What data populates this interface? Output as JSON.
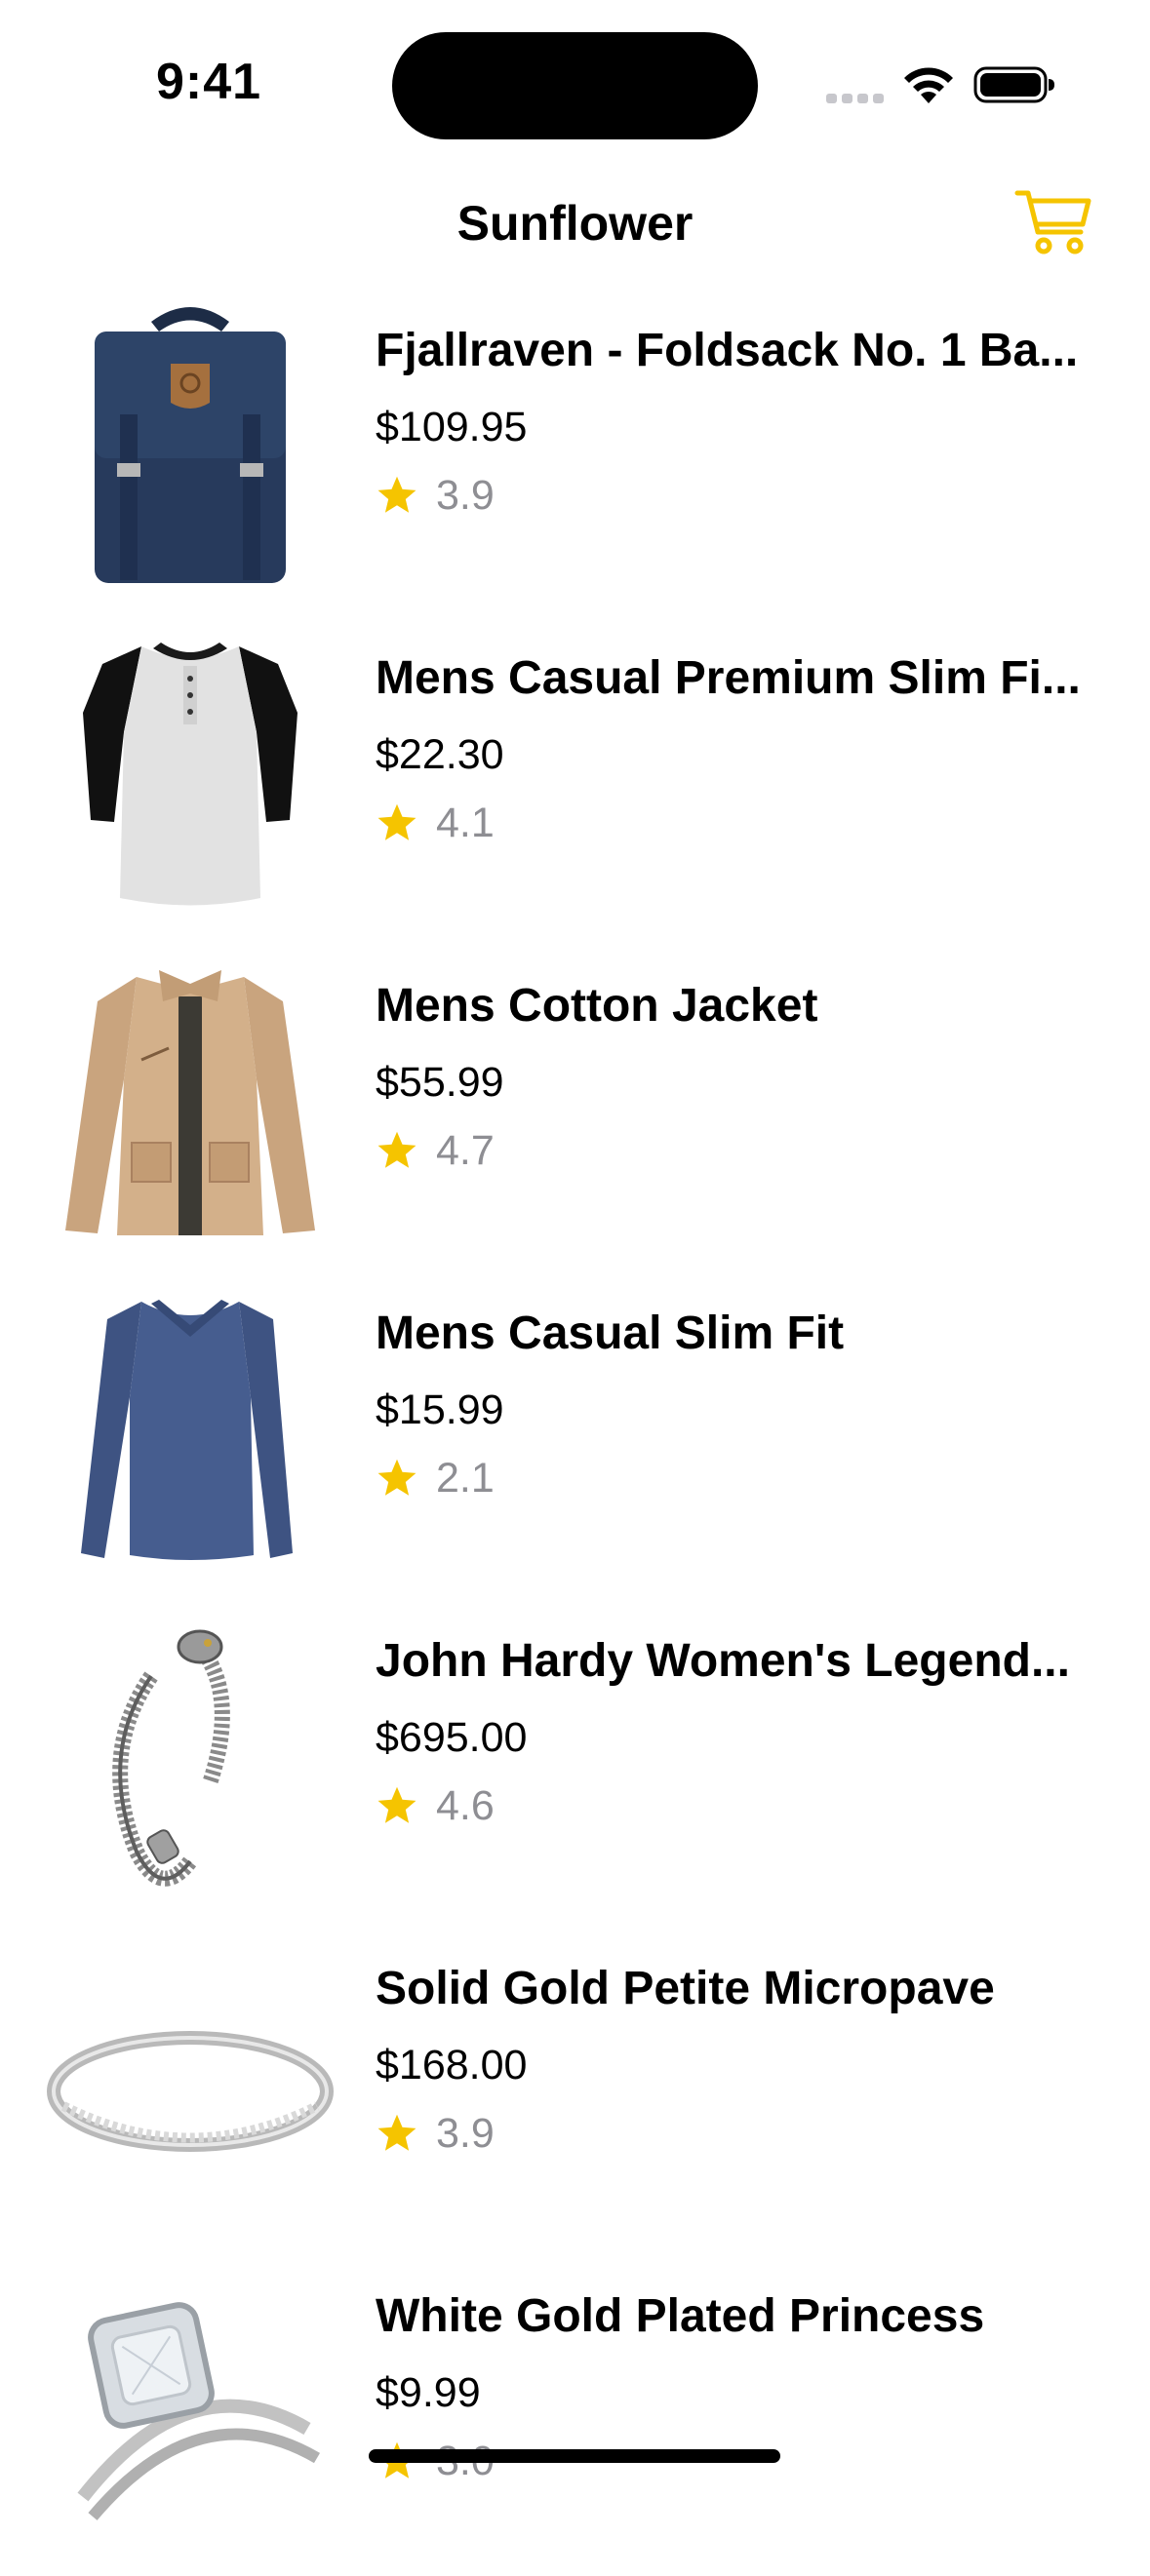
{
  "status_bar": {
    "time": "9:41"
  },
  "nav": {
    "title": "Sunflower",
    "cart_icon": "cart-icon"
  },
  "colors": {
    "accent": "#F5C400",
    "secondary_text": "#8E8E93"
  },
  "products": [
    {
      "title": "Fjallraven - Foldsack No. 1 Ba...",
      "price": "$109.95",
      "rating": "3.9",
      "image": "backpack"
    },
    {
      "title": "Mens Casual Premium Slim Fi...",
      "price": "$22.30",
      "rating": "4.1",
      "image": "raglan-tshirt"
    },
    {
      "title": "Mens Cotton Jacket",
      "price": "$55.99",
      "rating": "4.7",
      "image": "cotton-jacket"
    },
    {
      "title": "Mens Casual Slim Fit",
      "price": "$15.99",
      "rating": "2.1",
      "image": "long-sleeve-tee"
    },
    {
      "title": "John Hardy Women's Legend...",
      "price": "$695.00",
      "rating": "4.6",
      "image": "dragon-bracelet"
    },
    {
      "title": "Solid Gold Petite Micropave",
      "price": "$168.00",
      "rating": "3.9",
      "image": "micropave-ring"
    },
    {
      "title": "White Gold Plated Princess",
      "price": "$9.99",
      "rating": "3.0",
      "image": "princess-ring"
    }
  ]
}
